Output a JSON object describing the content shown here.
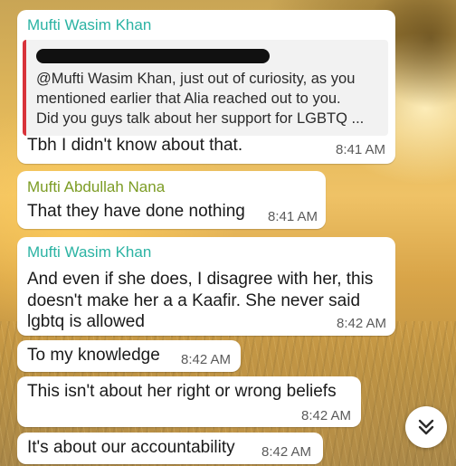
{
  "colors": {
    "sender_teal": "#2bb3a3",
    "sender_olive": "#7c9c24",
    "quote_bar": "#d8333a",
    "bubble_bg": "#ffffff",
    "time_gray": "#5b5b5b"
  },
  "messages": [
    {
      "sender": "Mufti Wasim Khan",
      "quote_lines": [
        "@Mufti Wasim Khan, just out of curiosity, as you",
        "mentioned earlier that Alia reached out to you.",
        "Did you guys talk about her support for LGBTQ ..."
      ],
      "text_lines": [
        "Tbh I didn't know about that."
      ],
      "time": "8:41 AM"
    },
    {
      "sender": "Mufti Abdullah Nana",
      "text_lines": [
        "That they have done nothing"
      ],
      "time": "8:41 AM"
    },
    {
      "sender": "Mufti Wasim Khan",
      "text_lines": [
        "And even if she does, I disagree with her, this",
        "doesn't make her a a Kaafir. She never said",
        "lgbtq is allowed"
      ],
      "time": "8:42 AM"
    },
    {
      "text_lines": [
        "To my knowledge"
      ],
      "time": "8:42 AM"
    },
    {
      "text_lines": [
        "This isn't about her right or wrong beliefs"
      ],
      "time": "8:42 AM"
    },
    {
      "text_lines": [
        "It's about our accountability"
      ],
      "time": "8:42 AM"
    }
  ],
  "scroll_down_icon": "double-chevron-down-icon"
}
